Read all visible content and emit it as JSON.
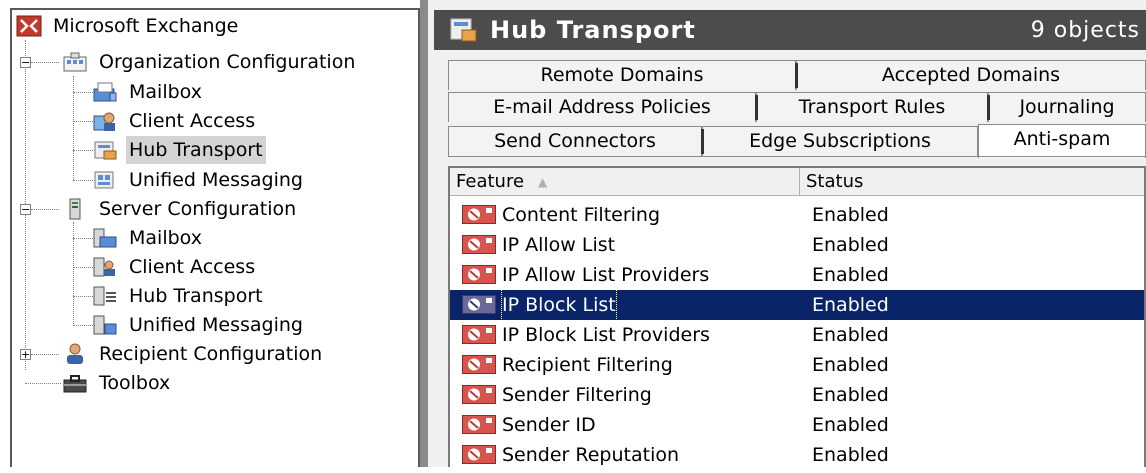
{
  "tree": {
    "root": {
      "label": "Microsoft Exchange",
      "icon": "exchange-icon"
    },
    "items": [
      {
        "label": "Organization Configuration",
        "icon": "organization-icon",
        "expander": "−"
      },
      {
        "label": "Mailbox",
        "icon": "mailbox-icon"
      },
      {
        "label": "Client Access",
        "icon": "client-access-icon"
      },
      {
        "label": "Hub Transport",
        "icon": "hub-transport-icon",
        "selected": true
      },
      {
        "label": "Unified Messaging",
        "icon": "unified-messaging-icon"
      },
      {
        "label": "Server Configuration",
        "icon": "server-icon",
        "expander": "−"
      },
      {
        "label": "Mailbox",
        "icon": "mailbox-server-icon"
      },
      {
        "label": "Client Access",
        "icon": "client-access-server-icon"
      },
      {
        "label": "Hub Transport",
        "icon": "hub-transport-server-icon"
      },
      {
        "label": "Unified Messaging",
        "icon": "unified-messaging-server-icon"
      },
      {
        "label": "Recipient Configuration",
        "icon": "recipient-icon",
        "expander": "+"
      },
      {
        "label": "Toolbox",
        "icon": "toolbox-icon"
      }
    ]
  },
  "header": {
    "title": "Hub Transport",
    "count": "9 objects",
    "icon": "hub-transport-icon"
  },
  "tabs": {
    "row1": [
      "Remote Domains",
      "Accepted Domains"
    ],
    "row2": [
      "E-mail Address Policies",
      "Transport Rules",
      "Journaling"
    ],
    "row3": [
      "Send Connectors",
      "Edge Subscriptions",
      "Anti-spam"
    ],
    "active": "Anti-spam"
  },
  "list": {
    "columns": {
      "feature": "Feature",
      "status": "Status"
    },
    "rows": [
      {
        "feature": "Content Filtering",
        "status": "Enabled"
      },
      {
        "feature": "IP Allow List",
        "status": "Enabled"
      },
      {
        "feature": "IP Allow List Providers",
        "status": "Enabled"
      },
      {
        "feature": "IP Block List",
        "status": "Enabled",
        "selected": true
      },
      {
        "feature": "IP Block List Providers",
        "status": "Enabled"
      },
      {
        "feature": "Recipient Filtering",
        "status": "Enabled"
      },
      {
        "feature": "Sender Filtering",
        "status": "Enabled"
      },
      {
        "feature": "Sender ID",
        "status": "Enabled"
      },
      {
        "feature": "Sender Reputation",
        "status": "Enabled"
      }
    ],
    "row_icon": "anti-spam-agent-icon"
  },
  "colors": {
    "selection": "#0a246a",
    "header_bar": "#4c4c4c",
    "tree_selection": "#d4d4d4"
  }
}
